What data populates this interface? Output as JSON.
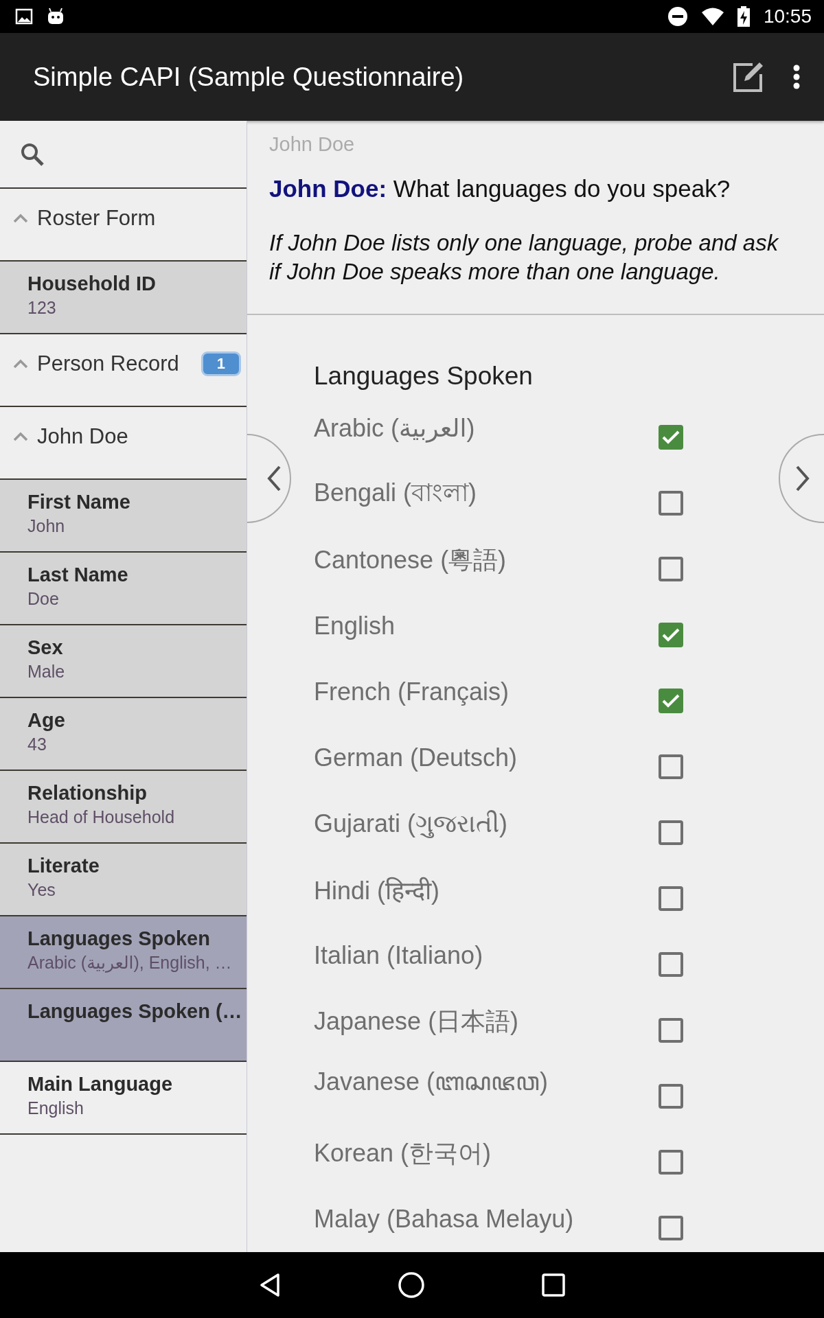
{
  "status_bar": {
    "time": "10:55"
  },
  "toolbar": {
    "title": "Simple CAPI (Sample Questionnaire)"
  },
  "sidebar": {
    "items": [
      {
        "kind": "group",
        "label": "Roster Form",
        "expanded": true
      },
      {
        "kind": "field",
        "label": "Household ID",
        "value": "123",
        "visited": true,
        "current": false
      },
      {
        "kind": "group",
        "label": "Person Record",
        "expanded": true,
        "badge": "1"
      },
      {
        "kind": "group",
        "label": "John Doe",
        "expanded": true
      },
      {
        "kind": "field",
        "label": "First Name",
        "value": "John",
        "visited": true,
        "current": false
      },
      {
        "kind": "field",
        "label": "Last Name",
        "value": "Doe",
        "visited": true,
        "current": false
      },
      {
        "kind": "field",
        "label": "Sex",
        "value": "Male",
        "visited": true,
        "current": false
      },
      {
        "kind": "field",
        "label": "Age",
        "value": "43",
        "visited": true,
        "current": false
      },
      {
        "kind": "field",
        "label": "Relationship",
        "value": "Head of Household",
        "visited": true,
        "current": false
      },
      {
        "kind": "field",
        "label": "Literate",
        "value": "Yes",
        "visited": true,
        "current": false
      },
      {
        "kind": "field",
        "label": "Languages Spoken",
        "value": "Arabic (العربية), English, …",
        "visited": true,
        "current": true
      },
      {
        "kind": "field",
        "label": "Languages Spoken (…",
        "visited": true,
        "current": true
      },
      {
        "kind": "field",
        "label": "Main Language",
        "value": "English",
        "visited": false,
        "current": false
      }
    ]
  },
  "question": {
    "roster_label": "John Doe",
    "prompt_name": "John Doe:",
    "prompt": "What languages do you speak?",
    "instructions": "If John Doe lists only one language, probe and ask if John Doe speaks more than one language.",
    "section_title": "Languages Spoken",
    "options": [
      {
        "label": "Arabic (العربية)",
        "checked": true
      },
      {
        "label": "Bengali (বাংলা)",
        "checked": false
      },
      {
        "label": "Cantonese (粵語)",
        "checked": false
      },
      {
        "label": "English",
        "checked": true
      },
      {
        "label": "French (Français)",
        "checked": true
      },
      {
        "label": "German (Deutsch)",
        "checked": false
      },
      {
        "label": "Gujarati (ગુજરાતી)",
        "checked": false
      },
      {
        "label": "Hindi (हिन्दी)",
        "checked": false
      },
      {
        "label": "Italian (Italiano)",
        "checked": false
      },
      {
        "label": "Japanese (日本語)",
        "checked": false
      },
      {
        "label": "Javanese (ꦧꦱꦗꦮ)",
        "checked": false
      },
      {
        "label": "Korean (한국어)",
        "checked": false
      },
      {
        "label": "Malay (Bahasa Melayu)",
        "checked": false
      }
    ]
  }
}
